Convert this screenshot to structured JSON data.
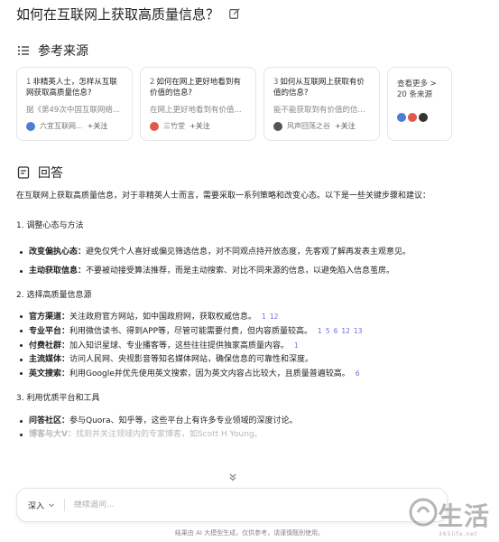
{
  "header": {
    "title": "如何在互联网上获取高质量信息？"
  },
  "sources": {
    "title": "参考来源",
    "items": [
      {
        "num": "1",
        "title": "非精英人士，怎样从互联网获取高质量信息?",
        "desc": "据《第49次中国互联网络...",
        "author": "六宜互联网...",
        "follow": "+关注",
        "avatar_color": "#4a7fd4"
      },
      {
        "num": "2",
        "title": "如何在网上更好地看到有价值的信息?",
        "desc": "在网上更好地看到有价值...",
        "author": "三竹堂",
        "follow": "+关注",
        "avatar_color": "#e05a4a"
      },
      {
        "num": "3",
        "title": "如何从互联网上获取有价值的信息?",
        "desc": "能不能获取到有价值的信...",
        "author": "风声回荡之谷",
        "follow": "+关注",
        "avatar_color": "#555555"
      }
    ],
    "more": {
      "label": "查看更多 > 20 条来源"
    }
  },
  "answer": {
    "title": "回答",
    "intro": "在互联网上获取高质量信息，对于非精英人士而言，需要采取一系列策略和改变心态。以下是一些关键步骤和建议：",
    "s1": {
      "heading": "1. 调整心态与方法",
      "i1_label": "改变偏执心态：",
      "i1_text": "避免仅凭个人喜好或偏见筛选信息，对不同观点持开放态度，先客观了解再发表主观意见。",
      "i2_label": "主动获取信息：",
      "i2_text": "不要被动接受算法推荐，而是主动搜索、对比不同来源的信息，以避免陷入信息茧房。"
    },
    "s2": {
      "heading": "2. 选择高质量信息源",
      "i1_label": "官方渠道：",
      "i1_text": "关注政府官方网站，如中国政府网，获取权威信息。",
      "i1_refs": [
        "1",
        "12"
      ],
      "i2_label": "专业平台：",
      "i2_text": "利用微信读书、得到APP等，尽管可能需要付费，但内容质量较高。",
      "i2_refs": [
        "1",
        "5",
        "6",
        "12",
        "13"
      ],
      "i3_label": "付费社群：",
      "i3_text": "加入知识星球、专业播客等，这些往往提供独家高质量内容。",
      "i3_refs": [
        "1"
      ],
      "i4_label": "主流媒体：",
      "i4_text": "访问人民网、央视影音等知名媒体网站，确保信息的可靠性和深度。",
      "i5_label": "英文搜索：",
      "i5_text": "利用Google并优先使用英文搜索，因为英文内容占比较大，且质量普遍较高。",
      "i5_refs": [
        "6"
      ]
    },
    "s3": {
      "heading": "3. 利用优质平台和工具",
      "i1_label": "问答社区：",
      "i1_text": "参与Quora、知乎等，这些平台上有许多专业领域的深度讨论。",
      "i2_label": "博客与大V：",
      "i2_text": "找到并关注领域内的专家博客，如Scott H Young。"
    }
  },
  "input": {
    "mode": "深入",
    "placeholder": "继续追问..."
  },
  "footer": {
    "disclaimer": "结果由 AI 大模型生成，仅供参考，请谨慎甄别使用。"
  },
  "watermark": {
    "text": "生活",
    "site": "365life.net"
  },
  "colors": {
    "ref": "#6a6fd6",
    "text": "#222222",
    "border": "#e6e6e6"
  }
}
